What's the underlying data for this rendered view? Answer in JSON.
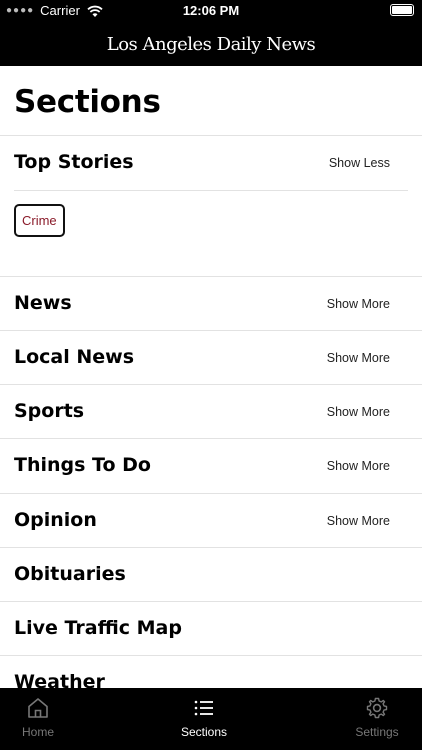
{
  "status": {
    "carrier": "Carrier",
    "time": "12:06 PM"
  },
  "masthead": {
    "title": "Los Angeles Daily News"
  },
  "page": {
    "title": "Sections"
  },
  "sections": [
    {
      "name": "Top Stories",
      "toggle": "Show Less"
    },
    {
      "name": "News",
      "toggle": "Show More"
    },
    {
      "name": "Local News",
      "toggle": "Show More"
    },
    {
      "name": "Sports",
      "toggle": "Show More"
    },
    {
      "name": "Things To Do",
      "toggle": "Show More"
    },
    {
      "name": "Opinion",
      "toggle": "Show More"
    },
    {
      "name": "Obituaries"
    },
    {
      "name": "Live Traffic Map"
    },
    {
      "name": "Weather"
    }
  ],
  "top_stories_subsections": [
    "Crime"
  ],
  "tabs": [
    {
      "label": "Home",
      "icon": "home-icon",
      "active": false
    },
    {
      "label": "Sections",
      "icon": "list-icon",
      "active": true
    },
    {
      "label": "Settings",
      "icon": "gear-icon",
      "active": false
    }
  ],
  "colors": {
    "chrome": "#000000",
    "chip_text": "#8a1b2a",
    "tab_inactive": "#777777",
    "tab_active": "#ffffff"
  }
}
